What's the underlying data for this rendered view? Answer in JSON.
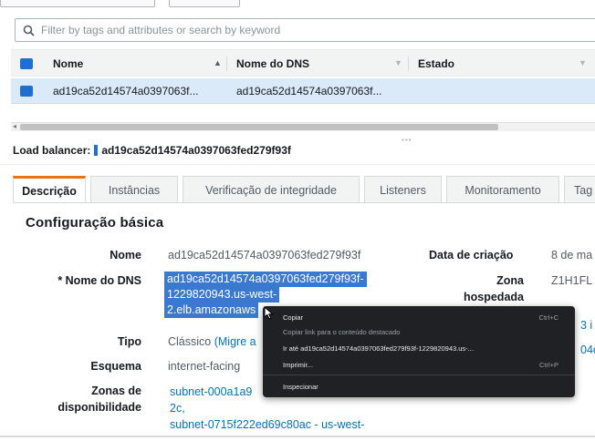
{
  "filter": {
    "placeholder": "Filter by tags and attributes or search by keyword"
  },
  "table": {
    "columns": [
      "Nome",
      "Nome do DNS",
      "Estado"
    ],
    "rows": [
      {
        "nome": "ad19ca52d14574a0397063f...",
        "dns": "ad19ca52d14574a0397063f..."
      }
    ]
  },
  "detail": {
    "title_label": "Load balancer:",
    "title_value": "ad19ca52d14574a0397063fed279f93f",
    "tabs": [
      "Descrição",
      "Instâncias",
      "Verificação de integridade",
      "Listeners",
      "Monitoramento",
      "Tag"
    ],
    "section_title": "Configuração básica",
    "fields": {
      "nome_label": "Nome",
      "nome_value": "ad19ca52d14574a0397063fed279f93f",
      "dns_label": "* Nome do DNS",
      "dns_value_lines": [
        "ad19ca52d14574a0397063fed279f93f-",
        "1229820943.us-west-",
        "2.elb.amazonaws"
      ],
      "tipo_label": "Tipo",
      "tipo_value": "Clássico",
      "tipo_link": "(Migre a",
      "esquema_label": "Esquema",
      "esquema_value": "internet-facing",
      "zonas_label_1": "Zonas de",
      "zonas_label_2": "disponibilidade",
      "subnet_1": "subnet-000a1a9",
      "subnet_1b": "2c,",
      "subnet_2": "subnet-0715f222ed69c80ac - us-west-",
      "data_label": "Data de criação",
      "data_value": "8 de ma",
      "zona_label_1": "Zona",
      "zona_label_2": "hospedada",
      "zona_value": "Z1H1FL",
      "right_frag_1": "3 i",
      "right_frag_2": "04c"
    }
  },
  "context_menu": {
    "items": [
      {
        "label": "Copiar",
        "shortcut": "Ctrl+C"
      },
      {
        "label": "Copiar link para o conteúdo destacado",
        "shortcut": ""
      },
      {
        "label": "Ir até ad19ca52d14574a0397063fed279f93f-1229820943.us-...",
        "shortcut": ""
      },
      {
        "label": "Imprimir...",
        "shortcut": "Ctrl+P"
      },
      {
        "label": "Inspecionar",
        "shortcut": ""
      }
    ]
  },
  "colors": {
    "accent": "#1f6fd1",
    "tab_active": "#ec7211",
    "link": "#0073bb",
    "selection": "#3a79cf",
    "row_selected": "#dbeaf8"
  }
}
